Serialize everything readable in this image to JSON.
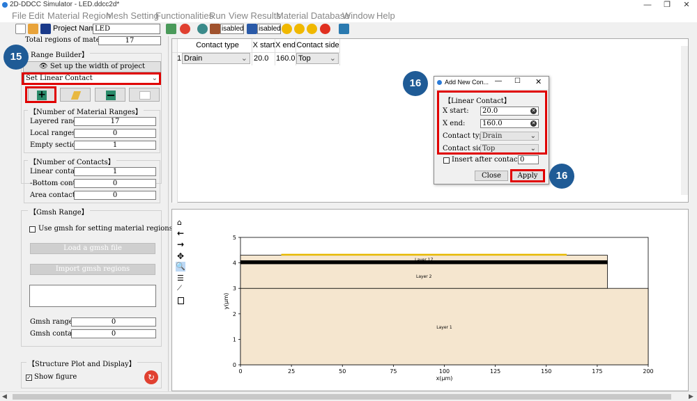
{
  "window": {
    "title": "2D-DDCC Simulator - LED.ddcc2d*",
    "minimize": "—",
    "maximize": "❐",
    "close": "✕"
  },
  "menu": [
    "File",
    "Edit",
    "Material Region",
    "Mesh Setting",
    "Functionalities",
    "Run",
    "View Results",
    "Material Database",
    "Window",
    "Help"
  ],
  "toolbar": {
    "project_label": "Project Name:",
    "project_value": "LED",
    "disabled_a": "isabled",
    "disabled_b": "isabled"
  },
  "left": {
    "total_regions_label": "Total regions of materials:",
    "total_regions_value": "17",
    "range_builder_header": "Range Builder】",
    "setup_width_button": "Set up the width of project",
    "range_mode": "Set Linear Contact",
    "num_material_ranges_header": "【Number of Material Ranges】",
    "layered_label": "Layered ranges:",
    "layered_value": "17",
    "local_label": "Local ranges:",
    "local_value": "0",
    "empty_label": "Empty sections:",
    "empty_value": "1",
    "num_contacts_header": "【Number of Contacts】",
    "linear_label": "Linear contact",
    "linear_value": "1",
    "bottom_label": "-Bottom conta",
    "bottom_value": "0",
    "area_label": "Area contacts:",
    "area_value": "0",
    "gmsh_header": "【Gmsh Range】",
    "use_gmsh_label": "Use gmsh for setting material regions",
    "load_gmsh_button": "Load a gmsh file",
    "import_gmsh_button": "Import gmsh regions",
    "gmsh_ranges_label": "Gmsh ranges:",
    "gmsh_ranges_value": "0",
    "gmsh_contacts_label": "Gmsh contacts:",
    "gmsh_contacts_value": "0",
    "structure_header": "【Structure Plot and Display】",
    "show_figure_label": "Show figure"
  },
  "contact_table": {
    "headers": [
      "Contact type",
      "X start",
      "X end",
      "Contact side"
    ],
    "rows": [
      {
        "index": "1",
        "type": "Drain",
        "xstart": "20.0",
        "xend": "160.0",
        "side": "Top"
      }
    ]
  },
  "dialog": {
    "title": "Add New Con...",
    "section": "【Linear Contact】",
    "xstart_label": "X start:",
    "xstart_value": "20.0",
    "xend_label": "X end:",
    "xend_value": "160.0",
    "type_label": "Contact type:",
    "type_value": "Drain",
    "side_label": "Contact side:",
    "side_value": "Top",
    "insert_label": "Insert after contact No.:",
    "insert_value": "0",
    "close_button": "Close",
    "apply_button": "Apply"
  },
  "annotations": {
    "step15": "15",
    "step16_top": "16",
    "step16_bottom": "16"
  },
  "chart_data": {
    "type": "area",
    "title": "",
    "xlabel": "x(μm)",
    "ylabel": "y(μm)",
    "xlim": [
      0,
      200
    ],
    "ylim": [
      0,
      5
    ],
    "xticks": [
      "0",
      "25",
      "50",
      "75",
      "100",
      "125",
      "150",
      "175",
      "200"
    ],
    "yticks": [
      "0",
      "1",
      "2",
      "3",
      "4",
      "5"
    ],
    "regions": [
      {
        "name": "Layer 1",
        "x": [
          0,
          200
        ],
        "y": [
          0,
          3
        ]
      },
      {
        "name": "Layer 2",
        "x": [
          0,
          180
        ],
        "y": [
          3,
          4
        ]
      },
      {
        "name": "Layer 17",
        "x": [
          0,
          180
        ],
        "y": [
          4,
          4.3
        ]
      }
    ],
    "contact": {
      "x": [
        20,
        160
      ],
      "y": 4.3,
      "color": "#e6b800"
    },
    "fill_color": "#f5e6cf"
  }
}
